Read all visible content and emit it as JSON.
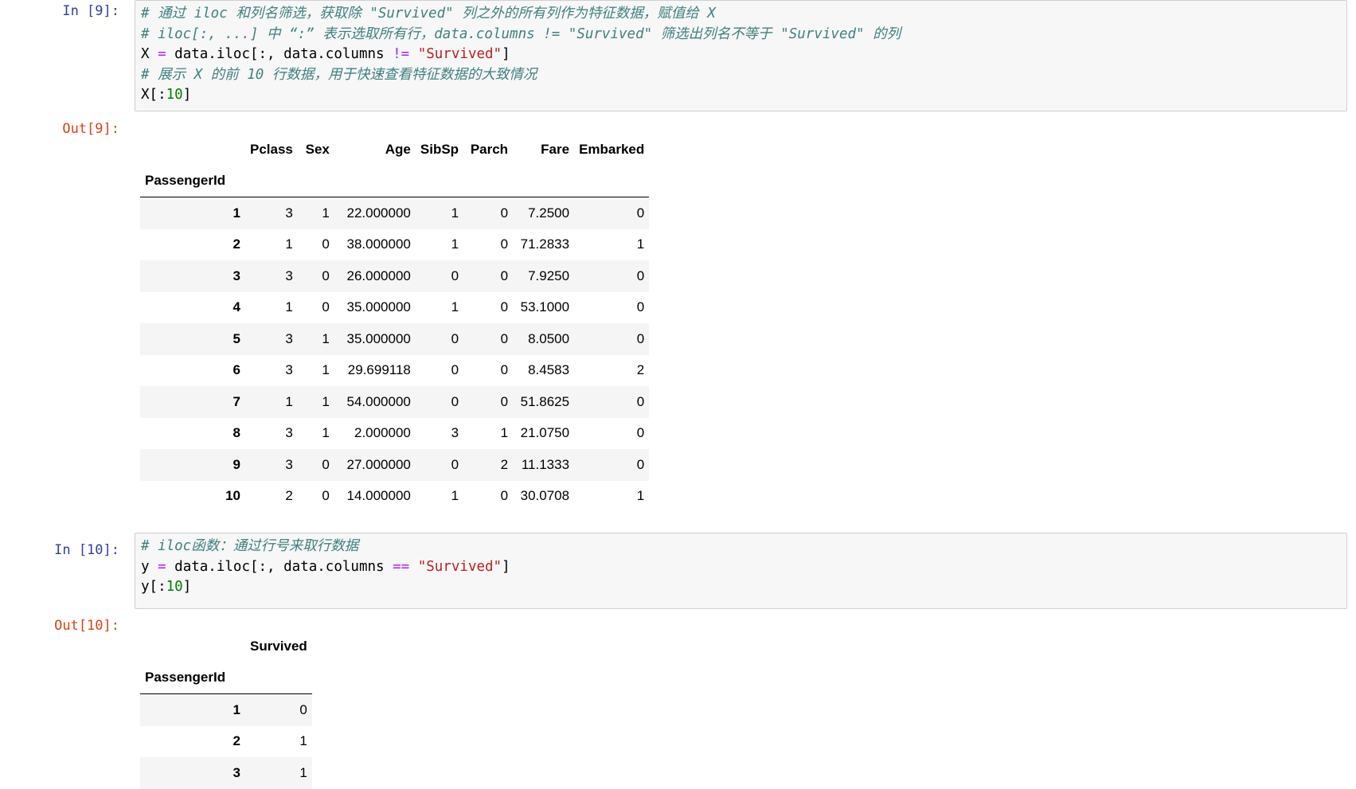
{
  "cell9": {
    "in_prompt": "In  [9]:",
    "out_prompt": "Out[9]:",
    "line1": "# 通过 iloc 和列名筛选，获取除 \"Survived\" 列之外的所有列作为特征数据，赋值给 X",
    "line2": "# iloc[:, ...] 中 “:” 表示选取所有行，data.columns != \"Survived\" 筛选出列名不等于 \"Survived\" 的列",
    "line3": {
      "a": "X ",
      "b": "=",
      "c": " data.iloc[:, data.columns ",
      "d": "!=",
      "e": " ",
      "f": "\"Survived\"",
      "g": "]"
    },
    "line4": "# 展示 X 的前 10 行数据，用于快速查看特征数据的大致情况",
    "line5": {
      "a": "X[:",
      "b": "10",
      "c": "]"
    },
    "table": {
      "index_name": "PassengerId",
      "columns": [
        "Pclass",
        "Sex",
        "Age",
        "SibSp",
        "Parch",
        "Fare",
        "Embarked"
      ],
      "rows": [
        [
          "1",
          "3",
          "1",
          "22.000000",
          "1",
          "0",
          "7.2500",
          "0"
        ],
        [
          "2",
          "1",
          "0",
          "38.000000",
          "1",
          "0",
          "71.2833",
          "1"
        ],
        [
          "3",
          "3",
          "0",
          "26.000000",
          "0",
          "0",
          "7.9250",
          "0"
        ],
        [
          "4",
          "1",
          "0",
          "35.000000",
          "1",
          "0",
          "53.1000",
          "0"
        ],
        [
          "5",
          "3",
          "1",
          "35.000000",
          "0",
          "0",
          "8.0500",
          "0"
        ],
        [
          "6",
          "3",
          "1",
          "29.699118",
          "0",
          "0",
          "8.4583",
          "2"
        ],
        [
          "7",
          "1",
          "1",
          "54.000000",
          "0",
          "0",
          "51.8625",
          "0"
        ],
        [
          "8",
          "3",
          "1",
          "2.000000",
          "3",
          "1",
          "21.0750",
          "0"
        ],
        [
          "9",
          "3",
          "0",
          "27.000000",
          "0",
          "2",
          "11.1333",
          "0"
        ],
        [
          "10",
          "2",
          "0",
          "14.000000",
          "1",
          "0",
          "30.0708",
          "1"
        ]
      ]
    }
  },
  "cell10": {
    "in_prompt": "In  [10]:",
    "out_prompt": "Out[10]:",
    "line1": "# iloc函数：通过行号来取行数据",
    "line2": {
      "a": "y ",
      "b": "=",
      "c": " data.iloc[:, data.columns ",
      "d": "==",
      "e": " ",
      "f": "\"Survived\"",
      "g": "]"
    },
    "line3": {
      "a": "y[:",
      "b": "10",
      "c": "]"
    },
    "table": {
      "index_name": "PassengerId",
      "columns": [
        "Survived"
      ],
      "rows": [
        [
          "1",
          "0"
        ],
        [
          "2",
          "1"
        ],
        [
          "3",
          "1"
        ]
      ]
    }
  }
}
